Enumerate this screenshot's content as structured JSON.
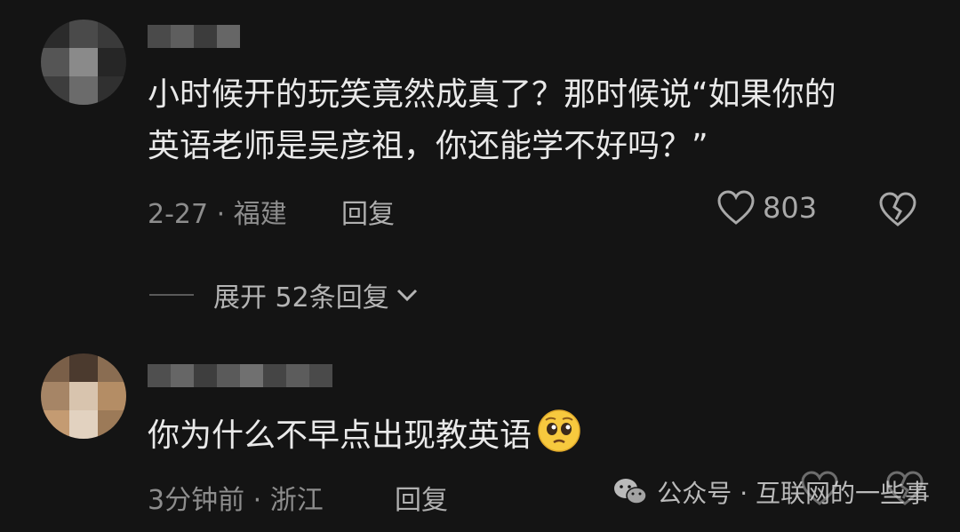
{
  "comments": [
    {
      "text_lines": [
        "小时候开的玩笑竟然成真了？那时候说“如果你的",
        "英语老师是吴彦祖，你还能学不好吗？”"
      ],
      "date": "2-27",
      "location": "福建",
      "reply_label": "回复",
      "likes": "803",
      "expand_label": "展开 52条回复"
    },
    {
      "text": "你为什么不早点出现教英语",
      "emoji": "pleading-face",
      "date": "3分钟前",
      "location": "浙江",
      "reply_label": "回复"
    }
  ],
  "watermark": {
    "text": "公众号 · 互联网的一些事",
    "icon": "wechat-icon"
  },
  "colors": {
    "background": "#141414",
    "text": "#e9e9e9",
    "meta": "#8d8d8d"
  }
}
